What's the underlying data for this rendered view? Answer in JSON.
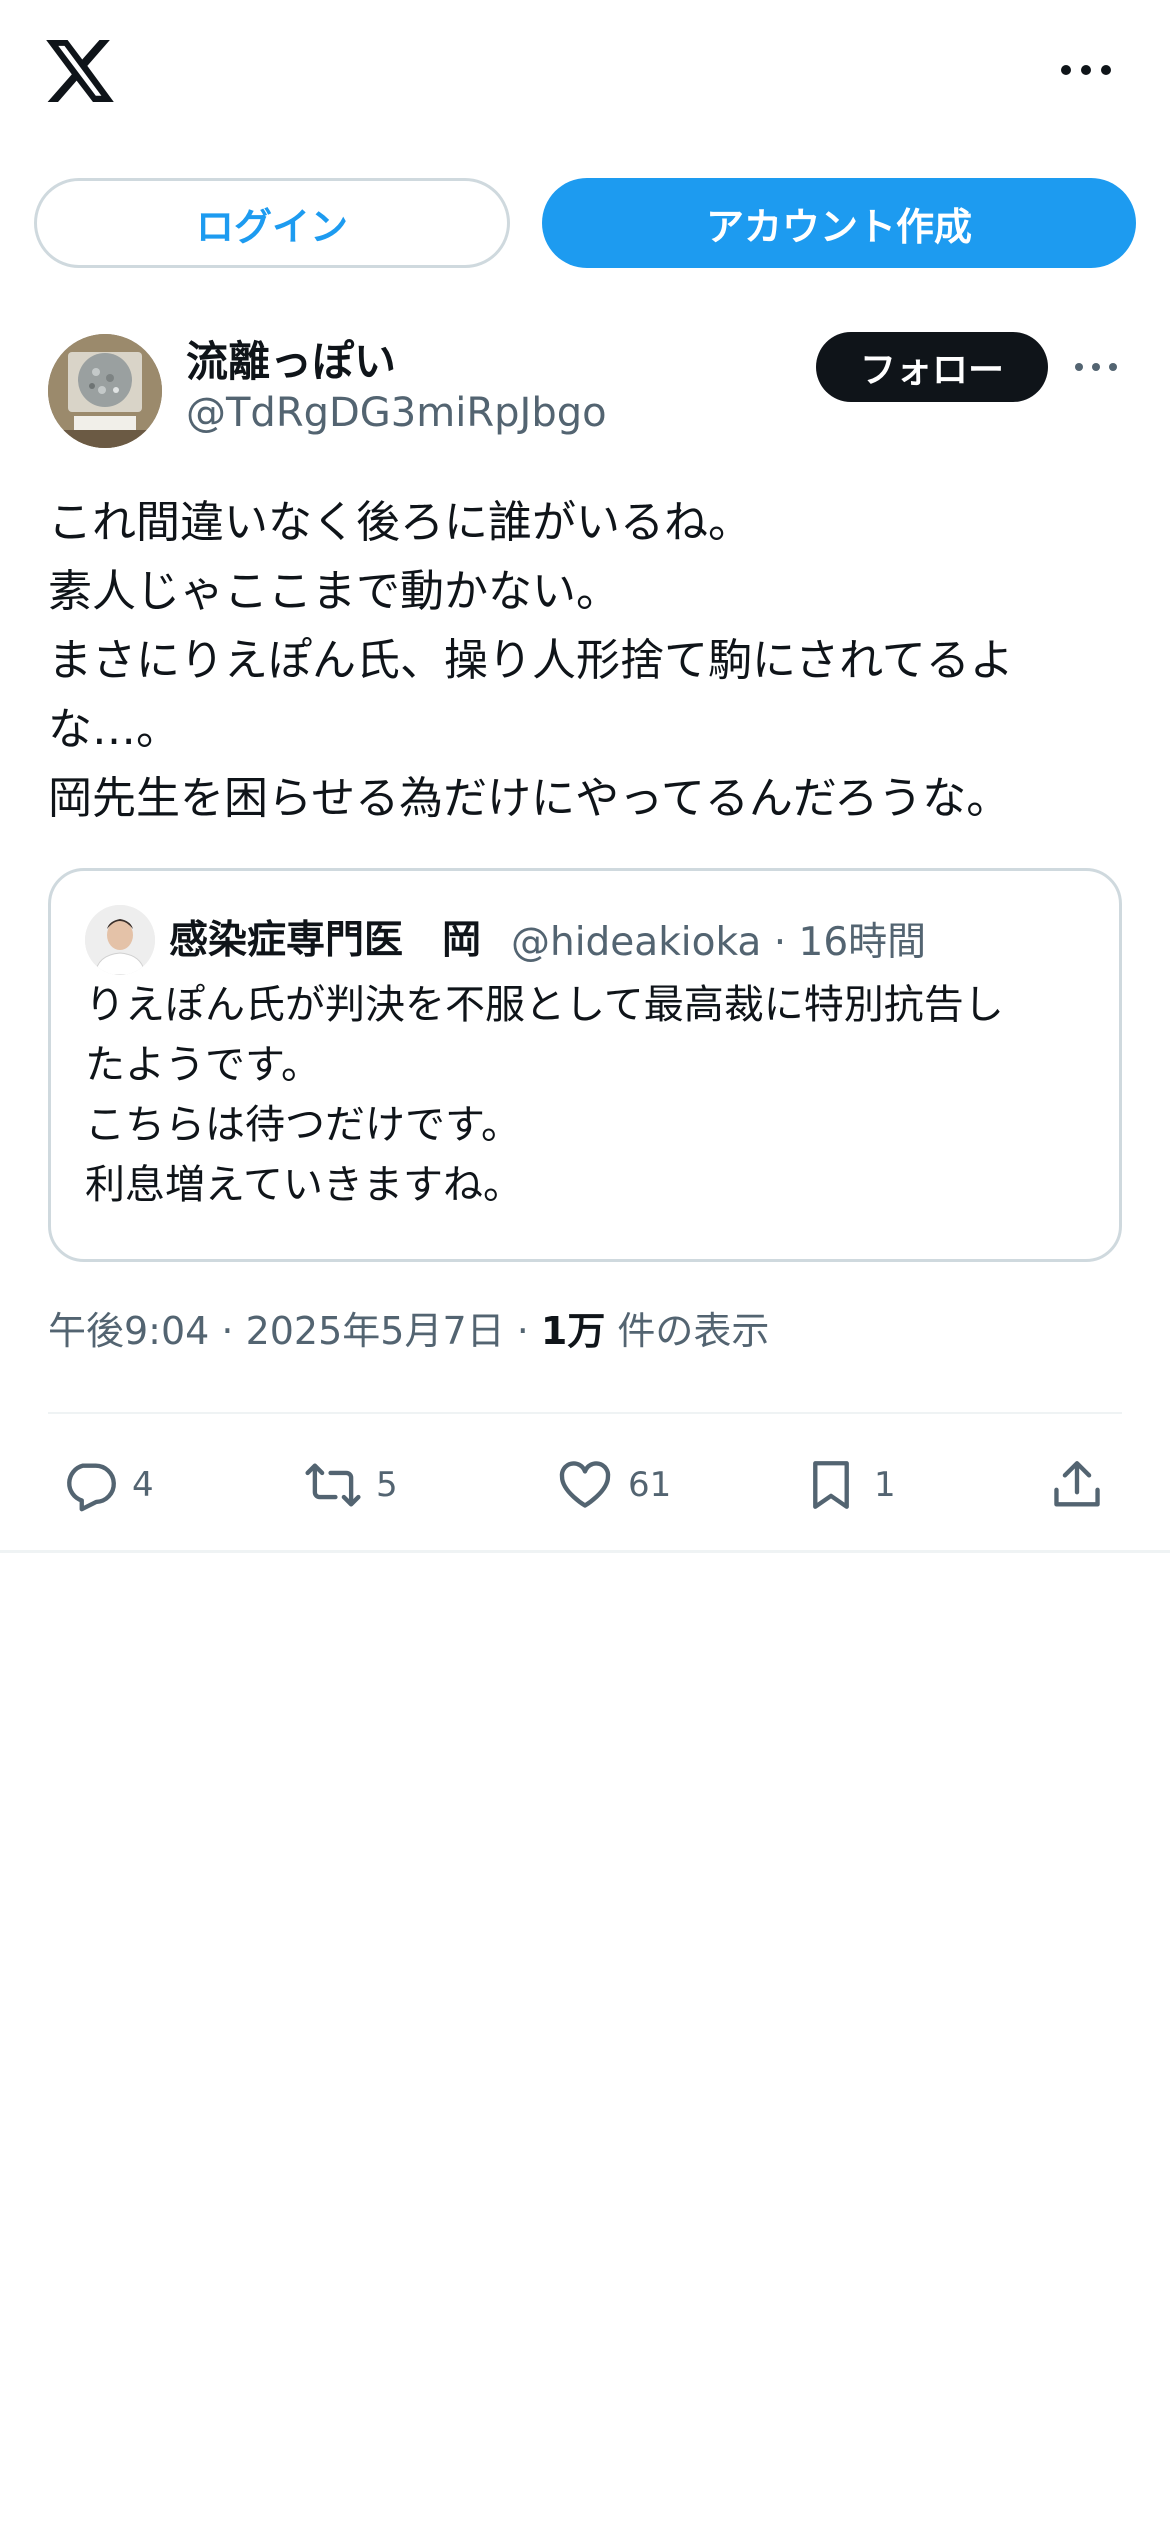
{
  "header": {
    "logo_icon": "x-logo-icon",
    "more_icon": "more-horizontal-icon"
  },
  "auth": {
    "login_label": "ログイン",
    "signup_label": "アカウント作成"
  },
  "tweet": {
    "author_name": "流離っぽい",
    "author_handle": "@TdRgDG3miRpJbgo",
    "follow_label": "フォロー",
    "body_lines": [
      "これ間違いなく後ろに誰がいるね。",
      "素人じゃここまで動かない。",
      "まさにりえぽん氏、操り人形捨て駒にされてるよ",
      "な…。",
      "岡先生を困らせる為だけにやってるんだろうな。"
    ],
    "quote": {
      "author_name": "感染症専門医　岡",
      "author_handle": "@hideakioka",
      "time": "16時間",
      "body_lines": [
        "りえぽん氏が判決を不服として最高裁に特別抗告し",
        "たようです。",
        "こちらは待つだけです。",
        "利息増えていきますね。"
      ]
    },
    "timestamp": "午後9:04 · 2025年5月7日 · ",
    "views_count": "1万",
    "views_label": " 件の表示",
    "actions": {
      "reply_count": "4",
      "retweet_count": "5",
      "like_count": "61",
      "bookmark_count": "1"
    }
  },
  "colors": {
    "accent": "#1d9bf0",
    "text_primary": "#0f1419",
    "text_secondary": "#536471",
    "border": "#cfd9de"
  }
}
